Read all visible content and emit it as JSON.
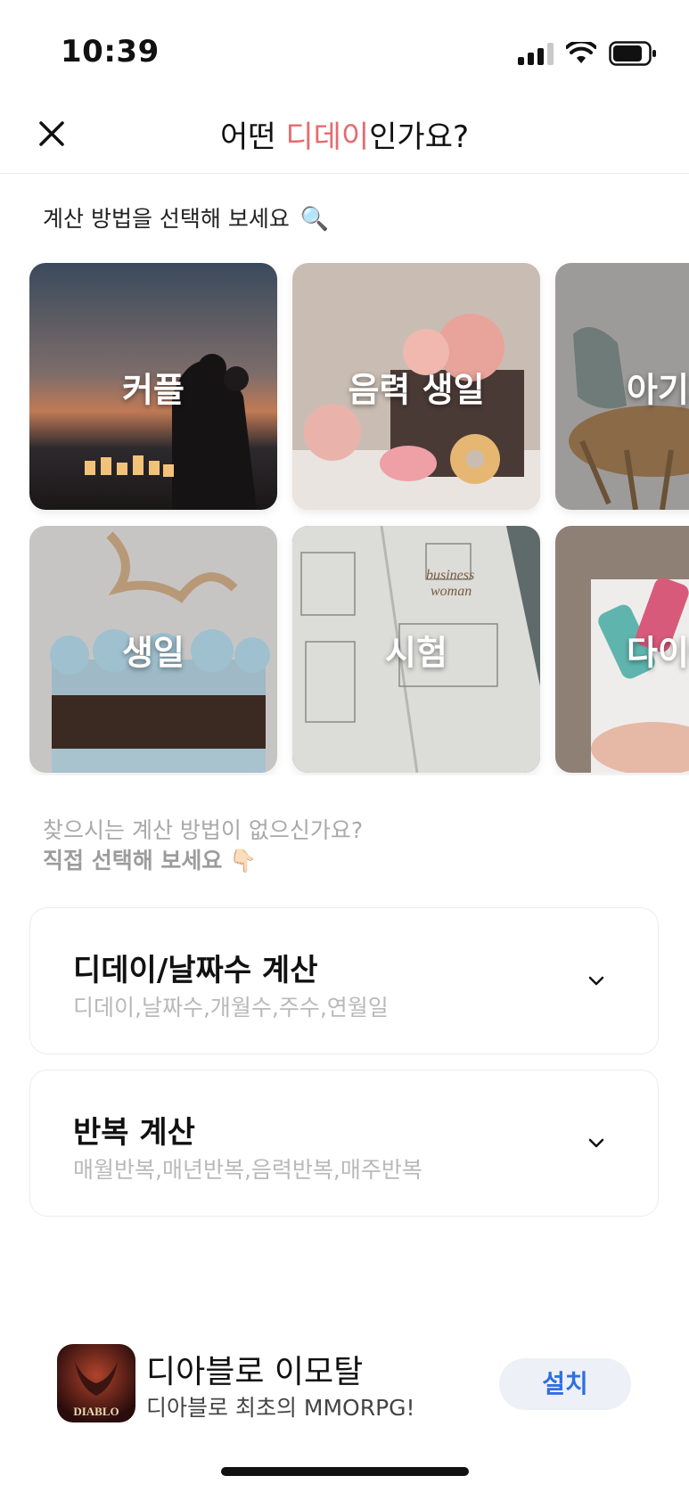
{
  "status_bar": {
    "time": "10:39"
  },
  "header": {
    "title_before": "어떤 ",
    "title_accent": "디데이",
    "title_after": "인가요?",
    "accent_color": "#e56b6f"
  },
  "section_hint": {
    "text": "계산 방법을 선택해 보세요",
    "emoji": "🔍"
  },
  "categories": [
    {
      "label": "커플"
    },
    {
      "label": "음력 생일"
    },
    {
      "label": "아기개"
    },
    {
      "label": "생일"
    },
    {
      "label": "시험"
    },
    {
      "label": "다이어"
    }
  ],
  "manual_hint": {
    "line1": "찾으시는 계산 방법이 없으신가요?",
    "line2": "직접 선택해 보세요",
    "emoji": "👇🏻"
  },
  "accordions": [
    {
      "title": "디데이/날짜수 계산",
      "subtitle": "디데이,날짜수,개월수,주수,연월일"
    },
    {
      "title": "반복 계산",
      "subtitle": "매월반복,매년반복,음력반복,매주반복"
    }
  ],
  "ad": {
    "title": "디아블로 이모탈",
    "subtitle": "디아블로 최초의 MMORPG!",
    "icon_text": "DIABLO",
    "install_label": "설치"
  }
}
